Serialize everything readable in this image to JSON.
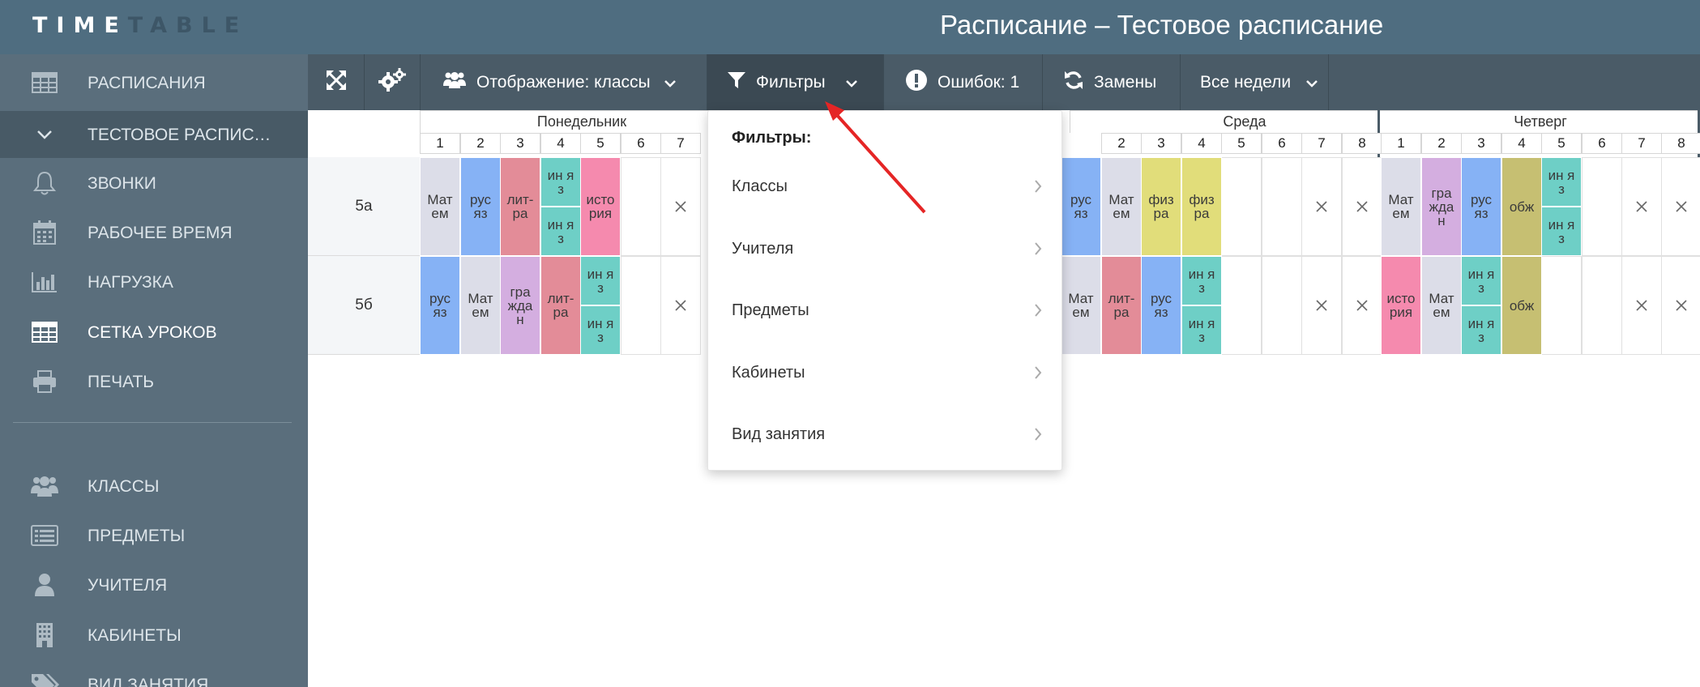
{
  "app": {
    "logo_bright": "TIME",
    "logo_dim": "TABLE",
    "page_title": "Расписание – Тестовое расписание"
  },
  "sidebar": {
    "items": [
      {
        "label": "РАСПИСАНИЯ",
        "icon": "table-icon"
      },
      {
        "label": "ТЕСТОВОЕ РАСПИСАНИЕ",
        "icon": "chevron-down-icon"
      },
      {
        "label": "ЗВОНКИ",
        "icon": "bell-icon"
      },
      {
        "label": "РАБОЧЕЕ ВРЕМЯ",
        "icon": "calendar-icon"
      },
      {
        "label": "НАГРУЗКА",
        "icon": "bar-chart-icon"
      },
      {
        "label": "СЕТКА УРОКОВ",
        "icon": "grid-icon"
      },
      {
        "label": "ПЕЧАТЬ",
        "icon": "printer-icon"
      },
      {
        "label": "КЛАССЫ",
        "icon": "users-icon"
      },
      {
        "label": "ПРЕДМЕТЫ",
        "icon": "list-icon"
      },
      {
        "label": "УЧИТЕЛЯ",
        "icon": "user-icon"
      },
      {
        "label": "КАБИНЕТЫ",
        "icon": "building-icon"
      },
      {
        "label": "ВИД ЗАНЯТИЯ",
        "icon": "tags-icon"
      }
    ]
  },
  "toolbar": {
    "display_label": "Отображение: классы",
    "filters_label": "Фильтры",
    "errors_label": "Ошибок: 1",
    "replacements_label": "Замены",
    "weeks_label": "Все недели"
  },
  "filter_menu": {
    "title": "Фильтры:",
    "items": [
      "Классы",
      "Учителя",
      "Предметы",
      "Кабинеты",
      "Вид занятия"
    ]
  },
  "schedule": {
    "days": [
      "Понедельник",
      "Среда",
      "Четверг"
    ],
    "classes": [
      "5а",
      "5б"
    ],
    "colors": {
      "math": "#dcdde8",
      "rus": "#86b2f5",
      "lit": "#e38c98",
      "lang": "#6ecfc6",
      "hist": "#f58aae",
      "civ": "#d4aee0",
      "phys": "#e1dd7a",
      "obzh": "#c6bf72"
    },
    "lessons": {
      "mat": "Мат ем",
      "rus": "рус яз",
      "lit": "лит- ра",
      "lang": "ин я з",
      "hist": "исто рия",
      "civ": "гра жда н",
      "phys": "физ ра",
      "obzh": "обж"
    }
  }
}
